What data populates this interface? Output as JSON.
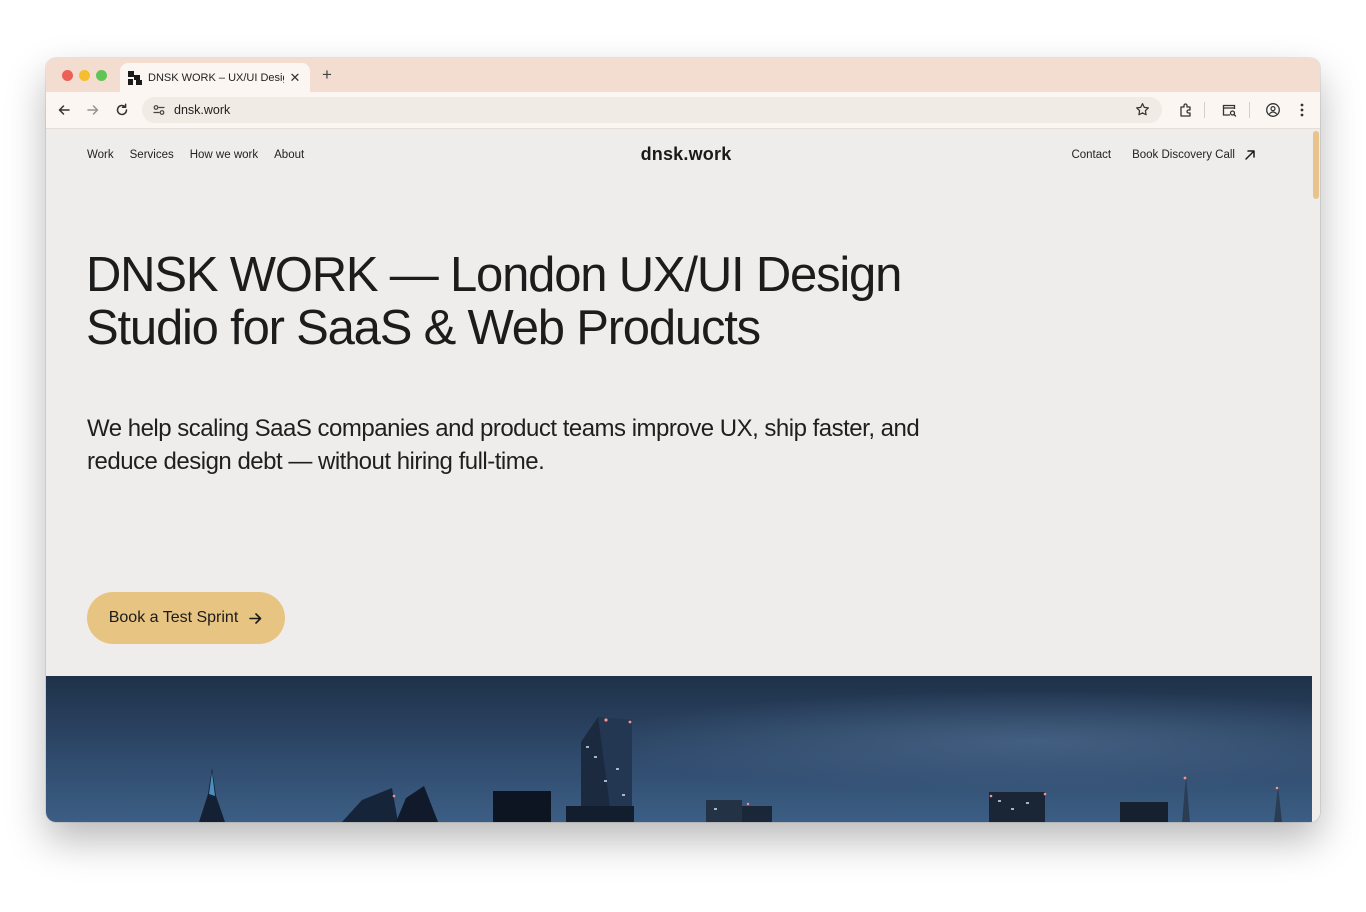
{
  "browser": {
    "tab_title": "DNSK WORK – UX/UI Design",
    "url": "dnsk.work",
    "colors": {
      "tab_strip": "#f2ddd0",
      "toolbar": "#fbf6f2"
    }
  },
  "site": {
    "logo": "dnsk.work",
    "nav_left": [
      "Work",
      "Services",
      "How we work",
      "About"
    ],
    "nav_right": {
      "contact": "Contact",
      "book_call": "Book Discovery Call"
    },
    "hero": {
      "title": "DNSK WORK — London UX/UI Design Studio for SaaS & Web Products",
      "subtitle": "We help scaling SaaS companies and product teams improve UX, ship faster, and reduce design debt — without hiring full-time.",
      "cta_label": "Book a Test Sprint"
    },
    "hero_image": "london-city-skyline-night",
    "colors": {
      "accent": "#e8c482",
      "page_bg": "#efedec",
      "text": "#1c1c1c"
    }
  },
  "icons": [
    "back-arrow-icon",
    "forward-arrow-icon",
    "reload-icon",
    "site-settings-icon",
    "star-icon",
    "extensions-icon",
    "tab-search-icon",
    "profile-icon",
    "menu-icon",
    "north-east-arrow-icon",
    "right-arrow-icon"
  ]
}
